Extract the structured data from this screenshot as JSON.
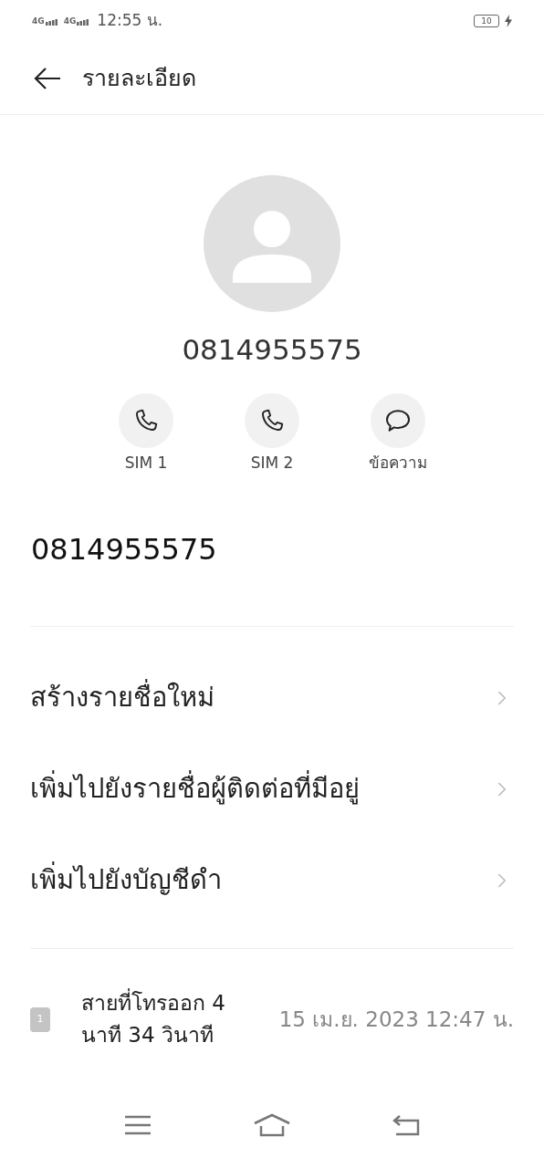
{
  "status_bar": {
    "network_1": "4G",
    "network_2": "4G",
    "time": "12:55 น.",
    "battery": "10",
    "charging": true
  },
  "header": {
    "title": "รายละเอียด"
  },
  "contact": {
    "number": "0814955575"
  },
  "actions": [
    {
      "kind": "call",
      "label": "SIM 1"
    },
    {
      "kind": "call",
      "label": "SIM 2"
    },
    {
      "kind": "message",
      "label": "ข้อความ"
    }
  ],
  "number_detail": "0814955575",
  "menu": [
    "สร้างรายชื่อใหม่",
    "เพิ่มไปยังรายชื่อผู้ติดต่อที่มีอยู่",
    "เพิ่มไปยังบัญชีดำ"
  ],
  "call_log": [
    {
      "sim": "1",
      "description": "สายที่โทรออก 4 นาที 34 วินาที",
      "datetime": "15 เม.ย. 2023 12:47 น."
    }
  ]
}
